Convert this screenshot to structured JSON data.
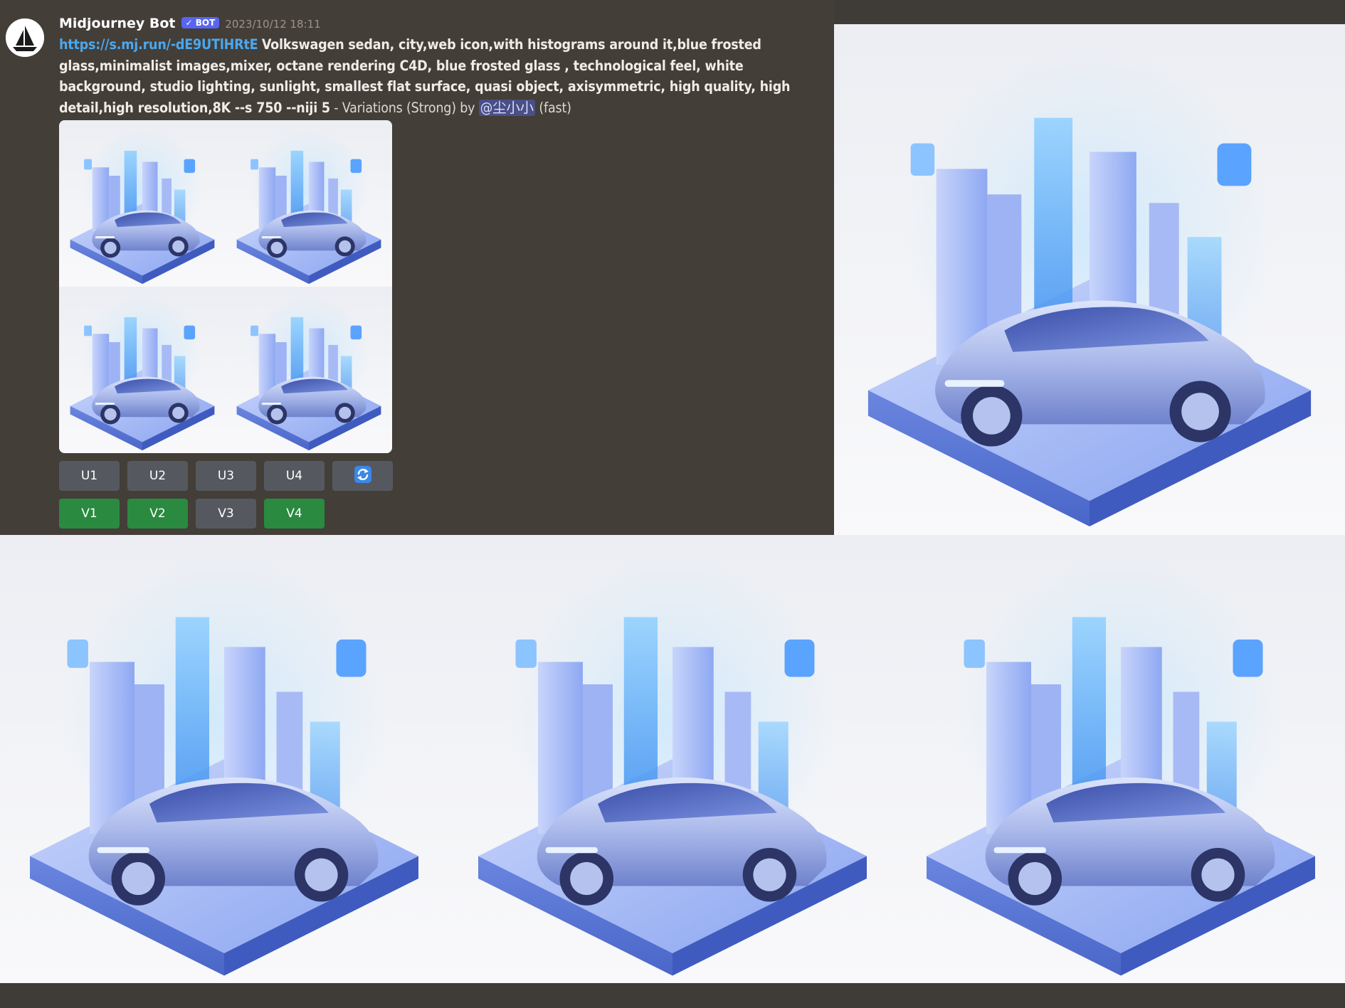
{
  "message": {
    "author": "Midjourney Bot",
    "badge": "✓ BOT",
    "timestamp": "2023/10/12 18:11",
    "link": "https://s.mj.run/-dE9UTlHRtE",
    "prompt": "Volkswagen sedan, city,web icon,with histograms around it,blue frosted glass,minimalist images,mixer, octane rendering C4D, blue frosted glass , technological feel, white background, studio lighting, sunlight, smallest flat surface, quasi object, axisymmetric, high quality,   high detail,high resolution,8K --s 750 --niji 5",
    "suffix": " - Variations (Strong) by ",
    "mention": "@尘小小",
    "speed": " (fast)"
  },
  "buttons": {
    "upscale": [
      "U1",
      "U2",
      "U3",
      "U4"
    ],
    "variation": [
      "V1",
      "V2",
      "V3",
      "V4"
    ],
    "reroll_icon": "refresh-icon"
  },
  "colors": {
    "background": "#3f3b36",
    "link": "#4aa8f0",
    "button_gray": "#55595f",
    "button_green": "#2a8a40",
    "mention_bg": "#4a4f86"
  }
}
